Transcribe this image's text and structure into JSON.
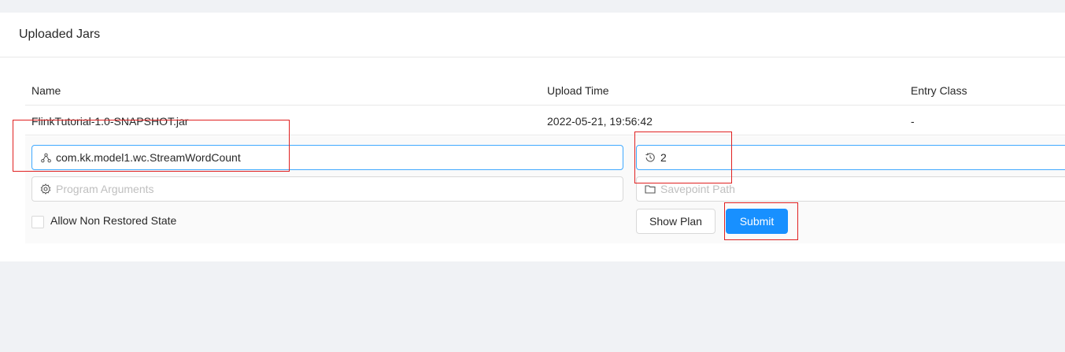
{
  "card": {
    "title": "Uploaded Jars"
  },
  "table": {
    "headers": {
      "name": "Name",
      "upload_time": "Upload Time",
      "entry_class": "Entry Class"
    },
    "row": {
      "name": "FlinkTutorial-1.0-SNAPSHOT.jar",
      "upload_time": "2022-05-21, 19:56:42",
      "entry_class": "-"
    }
  },
  "form": {
    "entry_class_value": "com.kk.model1.wc.StreamWordCount",
    "parallelism_value": "2",
    "program_args_placeholder": "Program Arguments",
    "savepoint_placeholder": "Savepoint Path",
    "allow_non_restored_label": "Allow Non Restored State",
    "show_plan_label": "Show Plan",
    "submit_label": "Submit"
  },
  "icons": {
    "entry_class": "cluster-icon",
    "parallelism": "history-icon",
    "program_args": "gear-icon",
    "savepoint": "folder-icon"
  },
  "colors": {
    "primary": "#1890ff",
    "highlight": "#e02020",
    "background": "#f0f2f5"
  }
}
